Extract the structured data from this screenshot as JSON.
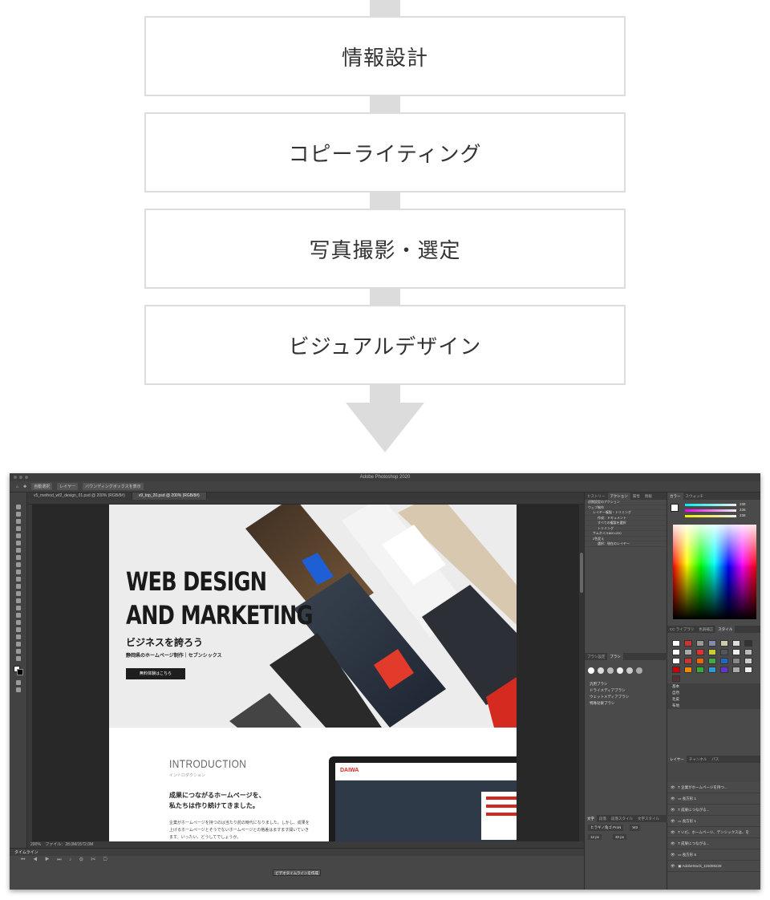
{
  "flow": {
    "steps": [
      {
        "label": "情報設計"
      },
      {
        "label": "コピーライティング"
      },
      {
        "label": "写真撮影・選定"
      },
      {
        "label": "ビジュアルデザイン"
      }
    ]
  },
  "photoshop": {
    "window_title": "Adobe Photoshop 2020",
    "options_bar": [
      "自動選択",
      "レイヤー",
      "バウンディングボックスを表示"
    ],
    "tabs": [
      "v5_method_wf2_design_01.psd @ 200% (RGB/8#)",
      "v9_top_20.psd @ 200% (RGB/8#)"
    ],
    "status": "200%",
    "status_file": "ファイル：28.0M/1572.0M",
    "timeline": {
      "label": "タイムライン",
      "create_button": "ビデオタイムラインを作成"
    },
    "document": {
      "hero_title_line1": "WEB DESIGN",
      "hero_title_line2": "AND MARKETING",
      "hero_sub": "ビジネスを誇ろう",
      "hero_small": "静岡県のホームページ制作｜セブンシックス",
      "hero_button": "無料体験はこちら",
      "intro_title": "INTRODUCTION",
      "intro_kana": "イントロダクション",
      "intro_lead_1": "成果につながるホームページを、",
      "intro_lead_2": "私たちは作り続けてきました。",
      "intro_body": "企業がホームページを持つのは当たり前の時代になりました。しかし、成果を上げるホームページとそうでないホームページとの格差はますます開いていきます。いったい、どうしてでしょうか。",
      "laptop_logo": "DAIWA"
    },
    "panels": {
      "history_tabs": [
        "ヒストリー",
        "アクション",
        "属性",
        "情報"
      ],
      "actions": [
        "初期設定のアクション",
        "ウェブ制作",
        "レイヤー複製・トリミング",
        "作成：ドキュメント",
        "すべての複製を選択",
        "トリミング",
        "サムネイル800×200",
        "2色変え",
        "選択：現在のレイヤー"
      ],
      "brush_tabs": [
        "ブラシ設定",
        "ブラシ"
      ],
      "brush_groups": [
        "汎用ブラシ",
        "ドライメディアブラシ",
        "ウェットメディアブラシ",
        "特殊効果ブラシ"
      ],
      "color_tabs": [
        "カラー",
        "スウォッチ"
      ],
      "rgb_values": {
        "r": "238",
        "g": "238",
        "b": "238"
      },
      "styles_tabs": [
        "CC ライブラリ",
        "色調補正",
        "スタイル"
      ],
      "style_folders": [
        "基本",
        "自然",
        "毛皮",
        "布地"
      ],
      "char_tabs": [
        "文字",
        "段落",
        "段落スタイル",
        "文字スタイル"
      ],
      "font": "ヒラギノ角ゴ ProN",
      "font_weight": "W3",
      "font_size": "12 px",
      "leading": "30 px",
      "layer_tabs": [
        "レイヤー",
        "チャンネル",
        "パス"
      ],
      "layers": [
        "企業がホームページを持つ...",
        "長方形 1",
        "成果につながる...",
        "長方形 1",
        "いだ、ホームページ、デンシックスは、を",
        "成果につながる...",
        "長方形 6",
        "AdobeStock_115058226"
      ]
    }
  }
}
